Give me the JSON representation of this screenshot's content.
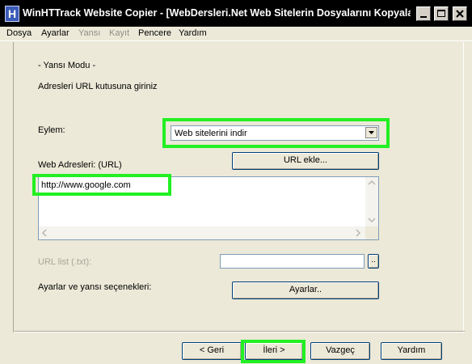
{
  "window": {
    "title": "WinHTTrack Website Copier - [WebDersleri.Net Web Sitelerin Dosyalarını Kopyalama.w..."
  },
  "menu": {
    "items": [
      {
        "label": "Dosya",
        "enabled": true
      },
      {
        "label": "Ayarlar",
        "enabled": true
      },
      {
        "label": "Yansı",
        "enabled": false
      },
      {
        "label": "Kayıt",
        "enabled": false
      },
      {
        "label": "Pencere",
        "enabled": true
      },
      {
        "label": "Yardım",
        "enabled": true
      }
    ]
  },
  "mirror": {
    "mode_heading": "- Yansı Modu -",
    "instruction": "Adresleri URL kutusuna giriniz",
    "action_label": "Eylem:",
    "action_value": "Web sitelerini indir",
    "add_url_button": "URL ekle...",
    "url_label": "Web Adresleri: (URL)",
    "url_value": "http://www.google.com",
    "url_list_label": "URL list (.txt):",
    "url_list_value": "",
    "url_list_browse": "..",
    "settings_label": "Ayarlar ve yansı seçenekleri:",
    "settings_button": "Ayarlar.."
  },
  "footer": {
    "back_button": "< Geri",
    "next_button": "İleri >",
    "cancel_button": "Vazgeç",
    "help_button": "Yardım"
  },
  "colors": {
    "highlight": "#22f022",
    "titlebar": "#000000",
    "dialog_bg": "#ece9d8"
  }
}
